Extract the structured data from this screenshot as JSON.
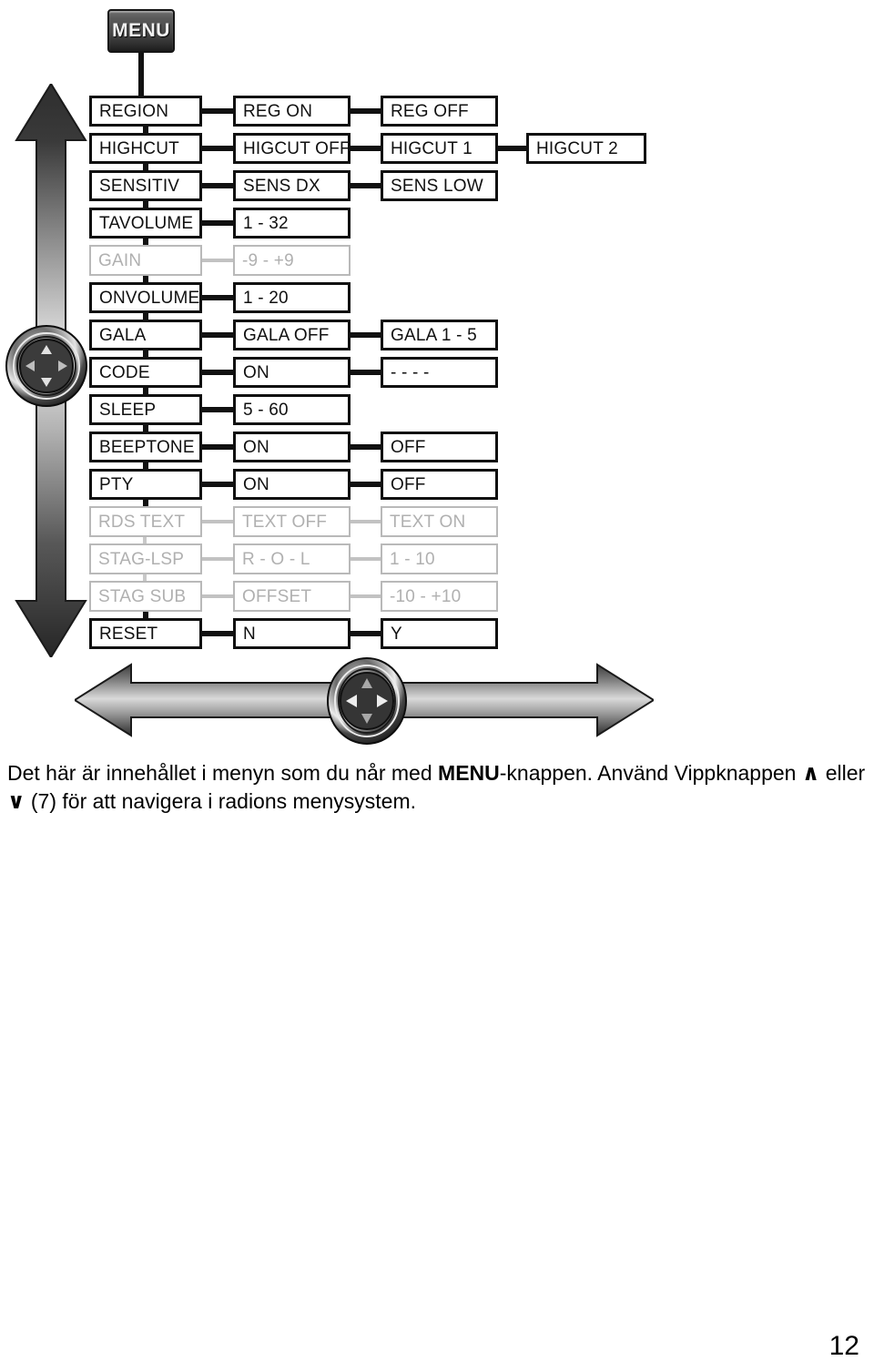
{
  "menu_button": {
    "label": "MENU",
    "icon": "menu-button"
  },
  "diagram": {
    "type": "menu-tree",
    "columns": 4,
    "rows": [
      {
        "item": "REGION",
        "options": [
          "REG ON",
          "REG OFF"
        ],
        "dim": false
      },
      {
        "item": "HIGHCUT",
        "options": [
          "HIGCUT OFF",
          "HIGCUT 1",
          "HIGCUT 2"
        ],
        "dim": false
      },
      {
        "item": "SENSITIV",
        "options": [
          "SENS DX",
          "SENS LOW"
        ],
        "dim": false
      },
      {
        "item": "TAVOLUME",
        "options": [
          "1 - 32"
        ],
        "dim": false
      },
      {
        "item": "GAIN",
        "options": [
          "-9 - +9"
        ],
        "dim": true
      },
      {
        "item": "ONVOLUME",
        "options": [
          "1 - 20"
        ],
        "dim": false
      },
      {
        "item": "GALA",
        "options": [
          "GALA OFF",
          "GALA 1 - 5"
        ],
        "dim": false
      },
      {
        "item": "CODE",
        "options": [
          "ON",
          "- - - -"
        ],
        "dim": false
      },
      {
        "item": "SLEEP",
        "options": [
          "5 - 60"
        ],
        "dim": false
      },
      {
        "item": "BEEPTONE",
        "options": [
          "ON",
          "OFF"
        ],
        "dim": false
      },
      {
        "item": "PTY",
        "options": [
          "ON",
          "OFF"
        ],
        "dim": false
      },
      {
        "item": "RDS TEXT",
        "options": [
          "TEXT OFF",
          "TEXT ON"
        ],
        "dim": true
      },
      {
        "item": "STAG-LSP",
        "options": [
          "R - O - L",
          "1 - 10"
        ],
        "dim": true
      },
      {
        "item": "STAG SUB",
        "options": [
          "OFFSET",
          "-10 - +10"
        ],
        "dim": true
      },
      {
        "item": "RESET",
        "options": [
          "N",
          "Y"
        ],
        "dim": false
      }
    ]
  },
  "arrows": {
    "vertical": "vertical-double-arrow",
    "horizontal": "horizontal-double-arrow"
  },
  "dpads": {
    "left": "navigation-dpad",
    "bottom": "navigation-dpad"
  },
  "caption": {
    "line1_part1": "Det här är innehållet i menyn som du når med ",
    "line1_bold": "MENU",
    "line1_part2": "-knappen. Använd Vippknappen",
    "glyph_up": "∧",
    "line2_part1": " eller ",
    "glyph_down": "∨",
    "line2_part2": " (7) för att navigera i radions menysystem."
  },
  "page_number": "12",
  "colors": {
    "ink": "#101010",
    "dim_ink": "#b0b0b0",
    "arrow_dark": "#2b2b2b",
    "arrow_light": "#d8d8d8"
  }
}
